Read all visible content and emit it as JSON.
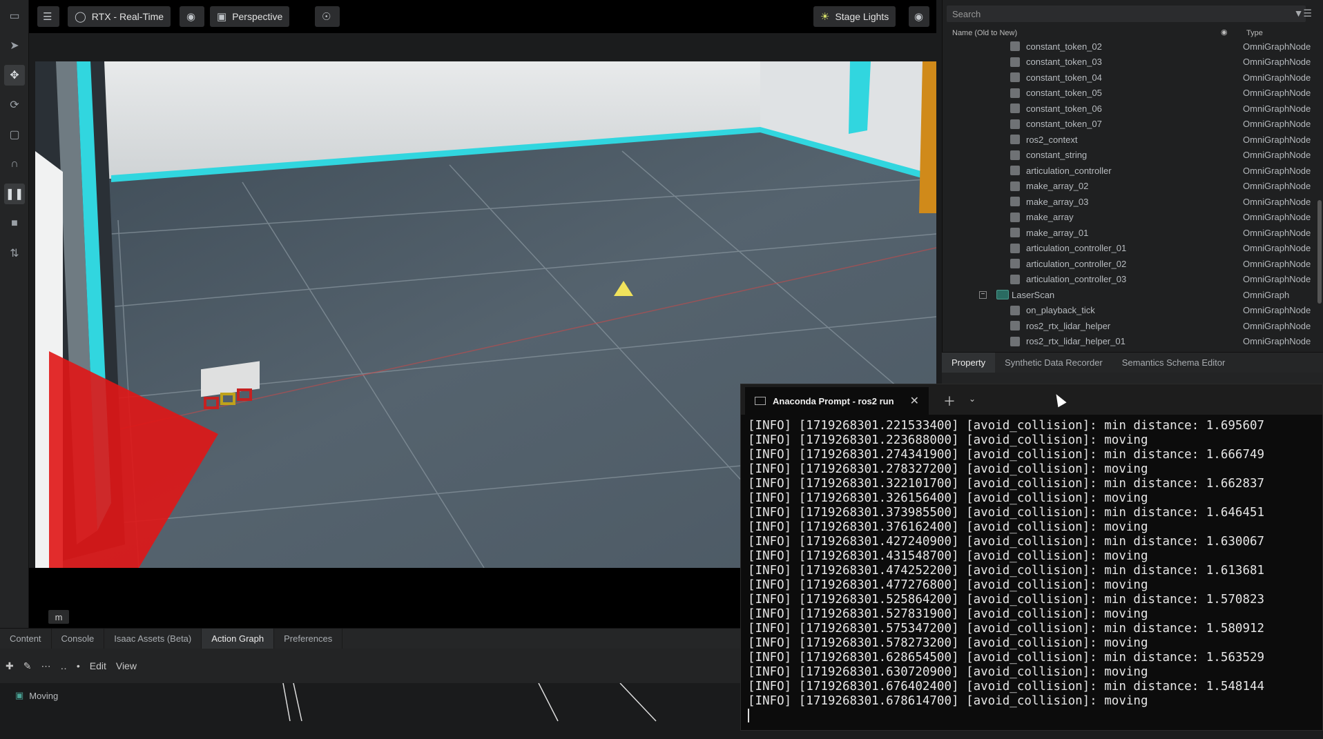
{
  "toolbar": {
    "render_mode": "RTX - Real-Time",
    "camera": "Perspective",
    "stage_lights": "Stage Lights"
  },
  "viewport": {
    "unit_label": "m"
  },
  "bottom_panel": {
    "tabs": [
      "Content",
      "Console",
      "Isaac Assets (Beta)",
      "Action Graph",
      "Preferences"
    ],
    "active_tab": "Action Graph",
    "menu": [
      "Edit",
      "View"
    ],
    "graph_item": "Moving"
  },
  "stage": {
    "search_placeholder": "Search",
    "col_name": "Name (Old to New)",
    "col_type": "Type",
    "rows": [
      {
        "name": "constant_token_02",
        "type": "OmniGraphNode"
      },
      {
        "name": "constant_token_03",
        "type": "OmniGraphNode"
      },
      {
        "name": "constant_token_04",
        "type": "OmniGraphNode"
      },
      {
        "name": "constant_token_05",
        "type": "OmniGraphNode"
      },
      {
        "name": "constant_token_06",
        "type": "OmniGraphNode"
      },
      {
        "name": "constant_token_07",
        "type": "OmniGraphNode"
      },
      {
        "name": "ros2_context",
        "type": "OmniGraphNode"
      },
      {
        "name": "constant_string",
        "type": "OmniGraphNode"
      },
      {
        "name": "articulation_controller",
        "type": "OmniGraphNode"
      },
      {
        "name": "make_array_02",
        "type": "OmniGraphNode"
      },
      {
        "name": "make_array_03",
        "type": "OmniGraphNode"
      },
      {
        "name": "make_array",
        "type": "OmniGraphNode"
      },
      {
        "name": "make_array_01",
        "type": "OmniGraphNode"
      },
      {
        "name": "articulation_controller_01",
        "type": "OmniGraphNode"
      },
      {
        "name": "articulation_controller_02",
        "type": "OmniGraphNode"
      },
      {
        "name": "articulation_controller_03",
        "type": "OmniGraphNode"
      },
      {
        "name": "LaserScan",
        "type": "OmniGraph",
        "group": true
      },
      {
        "name": "on_playback_tick",
        "type": "OmniGraphNode"
      },
      {
        "name": "ros2_rtx_lidar_helper",
        "type": "OmniGraphNode"
      },
      {
        "name": "ros2_rtx_lidar_helper_01",
        "type": "OmniGraphNode"
      }
    ]
  },
  "property_tabs": [
    "Property",
    "Synthetic Data Recorder",
    "Semantics Schema Editor"
  ],
  "terminal": {
    "title": "Anaconda Prompt - ros2  run",
    "lines": [
      "[INFO] [1719268301.221533400] [avoid_collision]: min distance: 1.695607",
      "[INFO] [1719268301.223688000] [avoid_collision]: moving",
      "[INFO] [1719268301.274341900] [avoid_collision]: min distance: 1.666749",
      "[INFO] [1719268301.278327200] [avoid_collision]: moving",
      "[INFO] [1719268301.322101700] [avoid_collision]: min distance: 1.662837",
      "[INFO] [1719268301.326156400] [avoid_collision]: moving",
      "[INFO] [1719268301.373985500] [avoid_collision]: min distance: 1.646451",
      "[INFO] [1719268301.376162400] [avoid_collision]: moving",
      "[INFO] [1719268301.427240900] [avoid_collision]: min distance: 1.630067",
      "[INFO] [1719268301.431548700] [avoid_collision]: moving",
      "[INFO] [1719268301.474252200] [avoid_collision]: min distance: 1.613681",
      "[INFO] [1719268301.477276800] [avoid_collision]: moving",
      "[INFO] [1719268301.525864200] [avoid_collision]: min distance: 1.570823",
      "[INFO] [1719268301.527831900] [avoid_collision]: moving",
      "[INFO] [1719268301.575347200] [avoid_collision]: min distance: 1.580912",
      "[INFO] [1719268301.578273200] [avoid_collision]: moving",
      "[INFO] [1719268301.628654500] [avoid_collision]: min distance: 1.563529",
      "[INFO] [1719268301.630720900] [avoid_collision]: moving",
      "[INFO] [1719268301.676402400] [avoid_collision]: min distance: 1.548144",
      "[INFO] [1719268301.678614700] [avoid_collision]: moving"
    ]
  }
}
